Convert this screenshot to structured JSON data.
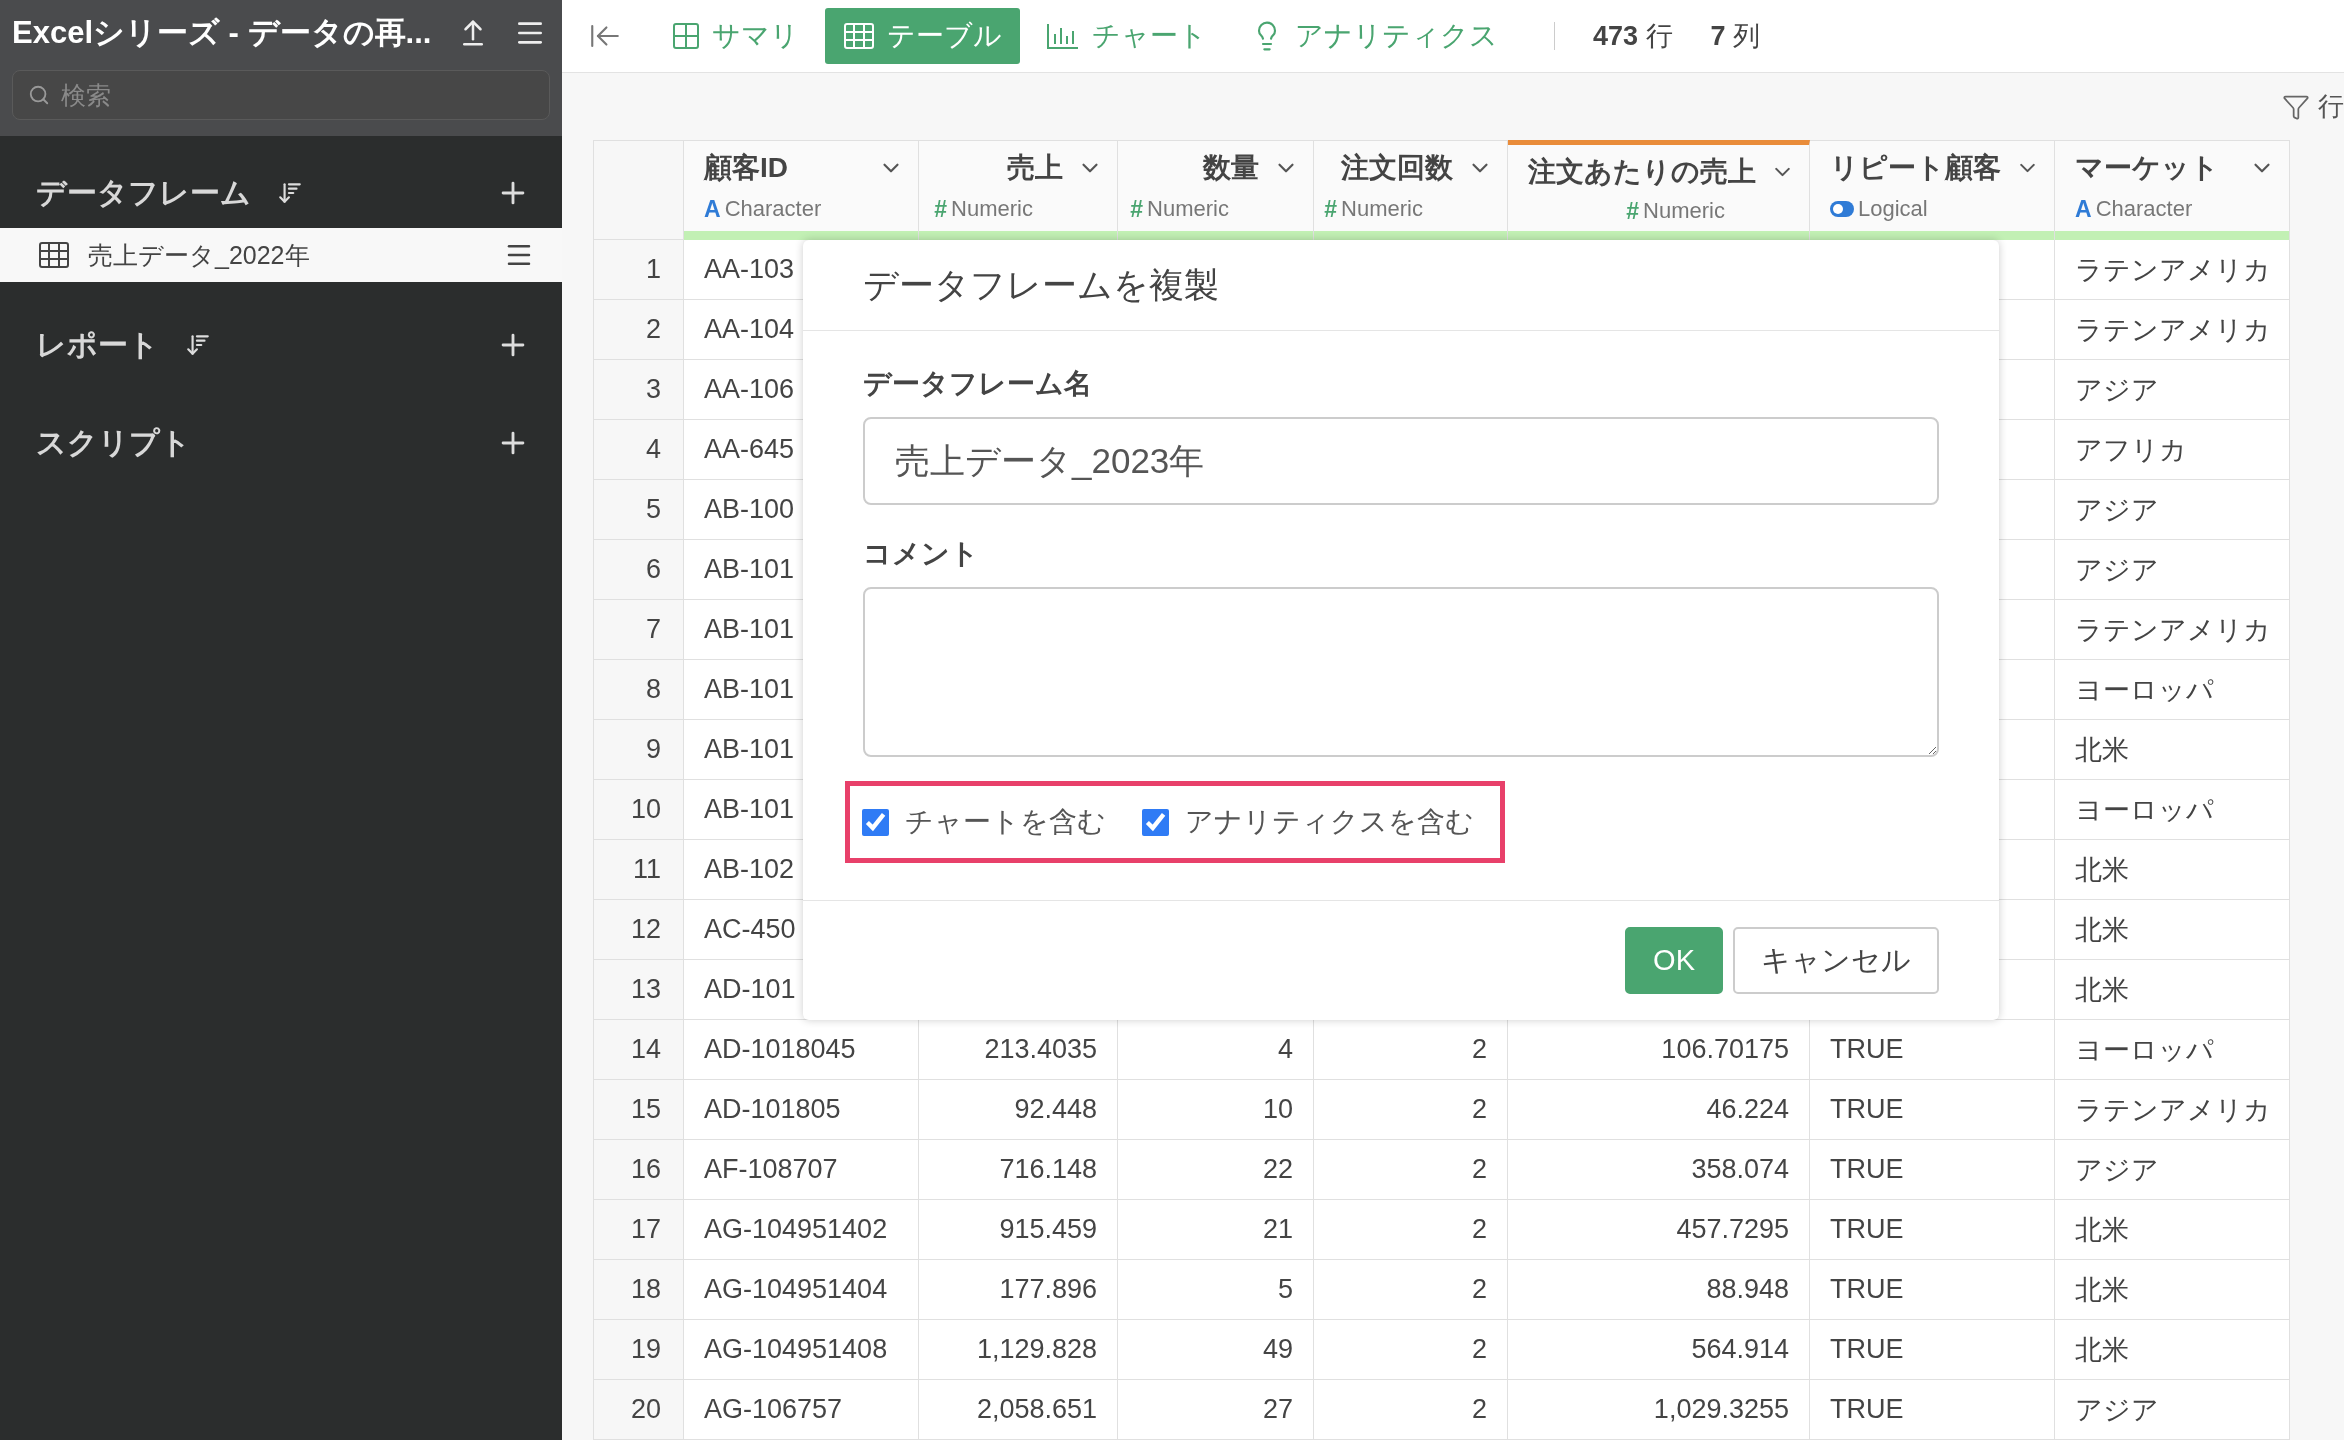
{
  "sidebar": {
    "title": "Excelシリーズ - データの再...",
    "search": {
      "placeholder": "検索"
    },
    "sections": [
      {
        "title": "データフレーム",
        "kind": "sortable",
        "items": [
          {
            "label": "売上データ_2022年",
            "selected": true
          }
        ]
      },
      {
        "title": "レポート",
        "kind": "sortable"
      },
      {
        "title": "スクリプト",
        "kind": "plain"
      }
    ]
  },
  "toolbar": {
    "tabs": [
      {
        "kind": "summary",
        "label": "サマリ",
        "selected": false
      },
      {
        "kind": "table",
        "label": "テーブル",
        "selected": true
      },
      {
        "kind": "chart",
        "label": "チャート",
        "selected": false
      },
      {
        "kind": "analytics",
        "label": "アナリティクス",
        "selected": false
      }
    ],
    "counts": [
      "**473** 行",
      "**7** 列"
    ],
    "filter_label": "行"
  },
  "table": {
    "columns": [
      {
        "name": "顧客ID",
        "selected": false,
        "type": {
          "kind": "character",
          "symbol": "A",
          "label": "Character"
        }
      },
      {
        "name": "売上",
        "selected": false,
        "type": {
          "kind": "numeric",
          "symbol": "#",
          "label": "Numeric"
        }
      },
      {
        "name": "数量",
        "selected": false,
        "type": {
          "kind": "numeric",
          "symbol": "#",
          "label": "Numeric"
        }
      },
      {
        "name": "注文回数",
        "selected": false,
        "type": {
          "kind": "numeric",
          "symbol": "#",
          "label": "Numeric"
        }
      },
      {
        "name": "注文あたりの売上",
        "selected": true,
        "type": {
          "kind": "numeric",
          "symbol": "#",
          "label": "Numeric"
        }
      },
      {
        "name": "リピート顧客",
        "selected": false,
        "type": {
          "kind": "logical",
          "label": "Logical"
        }
      },
      {
        "name": "マーケット",
        "selected": false,
        "type": {
          "kind": "character",
          "symbol": "A",
          "label": "Character"
        }
      }
    ],
    "rows": [
      {
        "index": "1",
        "cells": [
          "AA-103",
          null,
          null,
          null,
          null,
          null,
          "ラテンアメリカ"
        ]
      },
      {
        "index": "2",
        "cells": [
          "AA-104",
          null,
          null,
          null,
          null,
          null,
          "ラテンアメリカ"
        ]
      },
      {
        "index": "3",
        "cells": [
          "AA-106",
          null,
          null,
          null,
          null,
          null,
          "アジア"
        ]
      },
      {
        "index": "4",
        "cells": [
          "AA-645",
          null,
          null,
          null,
          null,
          null,
          "アフリカ"
        ]
      },
      {
        "index": "5",
        "cells": [
          "AB-100",
          null,
          null,
          null,
          null,
          null,
          "アジア"
        ]
      },
      {
        "index": "6",
        "cells": [
          "AB-101",
          null,
          null,
          null,
          null,
          null,
          "アジア"
        ]
      },
      {
        "index": "7",
        "cells": [
          "AB-101",
          null,
          null,
          null,
          null,
          null,
          "ラテンアメリカ"
        ]
      },
      {
        "index": "8",
        "cells": [
          "AB-101",
          null,
          null,
          null,
          null,
          null,
          "ヨーロッパ"
        ]
      },
      {
        "index": "9",
        "cells": [
          "AB-101",
          null,
          null,
          null,
          null,
          null,
          "北米"
        ]
      },
      {
        "index": "10",
        "cells": [
          "AB-101",
          null,
          null,
          null,
          null,
          null,
          "ヨーロッパ"
        ]
      },
      {
        "index": "11",
        "cells": [
          "AB-102",
          null,
          null,
          null,
          null,
          null,
          "北米"
        ]
      },
      {
        "index": "12",
        "cells": [
          "AC-450",
          null,
          null,
          null,
          null,
          null,
          "北米"
        ]
      },
      {
        "index": "13",
        "cells": [
          "AD-101",
          null,
          null,
          null,
          null,
          null,
          "北米"
        ]
      },
      {
        "index": "14",
        "cells": [
          "AD-1018045",
          "213.4035",
          "4",
          "2",
          "106.70175",
          "TRUE",
          "ヨーロッパ"
        ]
      },
      {
        "index": "15",
        "cells": [
          "AD-101805",
          "92.448",
          "10",
          "2",
          "46.224",
          "TRUE",
          "ラテンアメリカ"
        ]
      },
      {
        "index": "16",
        "cells": [
          "AF-108707",
          "716.148",
          "22",
          "2",
          "358.074",
          "TRUE",
          "アジア"
        ]
      },
      {
        "index": "17",
        "cells": [
          "AG-104951402",
          "915.459",
          "21",
          "2",
          "457.7295",
          "TRUE",
          "北米"
        ]
      },
      {
        "index": "18",
        "cells": [
          "AG-104951404",
          "177.896",
          "5",
          "2",
          "88.948",
          "TRUE",
          "北米"
        ]
      },
      {
        "index": "19",
        "cells": [
          "AG-104951408",
          "1,129.828",
          "49",
          "2",
          "564.914",
          "TRUE",
          "北米"
        ]
      },
      {
        "index": "20",
        "cells": [
          "AG-106757",
          "2,058.651",
          "27",
          "2",
          "1,029.3255",
          "TRUE",
          "アジア"
        ]
      }
    ]
  },
  "dialog": {
    "title": "データフレームを複製",
    "name_label": "データフレーム名",
    "name_value": "売上データ_2023年",
    "comment_label": "コメント",
    "options": [
      {
        "label": "チャートを含む",
        "checked": true
      },
      {
        "label": "アナリティクスを含む",
        "checked": true
      }
    ],
    "highlighted": true,
    "buttons": [
      {
        "kind": "primary",
        "label": "OK"
      },
      {
        "kind": "default",
        "label": "キャンセル"
      }
    ]
  }
}
